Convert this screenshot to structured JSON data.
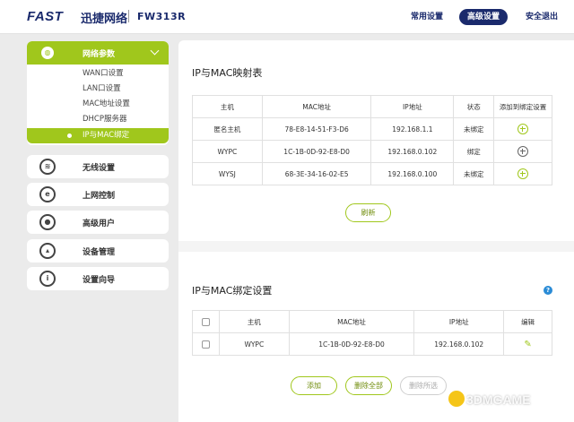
{
  "header": {
    "logo": "FAST",
    "brand_cn": "迅捷网络",
    "model": "FW313R",
    "nav": {
      "basic": "常用设置",
      "advanced": "高级设置",
      "wizard": "安全退出"
    }
  },
  "sidebar": {
    "network": {
      "label": "网络参数",
      "items": [
        "WAN口设置",
        "LAN口设置",
        "MAC地址设置",
        "DHCP服务器",
        "IP与MAC绑定"
      ]
    },
    "wireless": "无线设置",
    "internet_control": "上网控制",
    "advanced_user": "高级用户",
    "device_mgmt": "设备管理",
    "setup_wizard": "设置向导"
  },
  "map_section": {
    "title": "IP与MAC映射表",
    "columns": [
      "主机",
      "MAC地址",
      "IP地址",
      "状态",
      "添加到绑定设置"
    ],
    "rows": [
      {
        "host": "匿名主机",
        "mac": "78-E8-14-51-F3-D6",
        "ip": "192.168.1.1",
        "status": "未绑定",
        "action": "plus-green"
      },
      {
        "host": "WYPC",
        "mac": "1C-1B-0D-92-E8-D0",
        "ip": "192.168.0.102",
        "status": "绑定",
        "action": "plus-gray"
      },
      {
        "host": "WYSJ",
        "mac": "68-3E-34-16-02-E5",
        "ip": "192.168.0.100",
        "status": "未绑定",
        "action": "plus-green"
      }
    ],
    "refresh_label": "刷新"
  },
  "bind_section": {
    "title": "IP与MAC绑定设置",
    "columns": [
      "",
      "主机",
      "MAC地址",
      "IP地址",
      "编辑"
    ],
    "rows": [
      {
        "host": "WYPC",
        "mac": "1C-1B-0D-92-E8-D0",
        "ip": "192.168.0.102"
      }
    ],
    "add_label": "添加",
    "delete_all_label": "删除全部",
    "delete_selected_label": "删除所选"
  },
  "watermark": "3DMGAME",
  "colors": {
    "accent": "#a0c71c",
    "brand": "#1a2a6c",
    "help": "#2a8bd6"
  }
}
